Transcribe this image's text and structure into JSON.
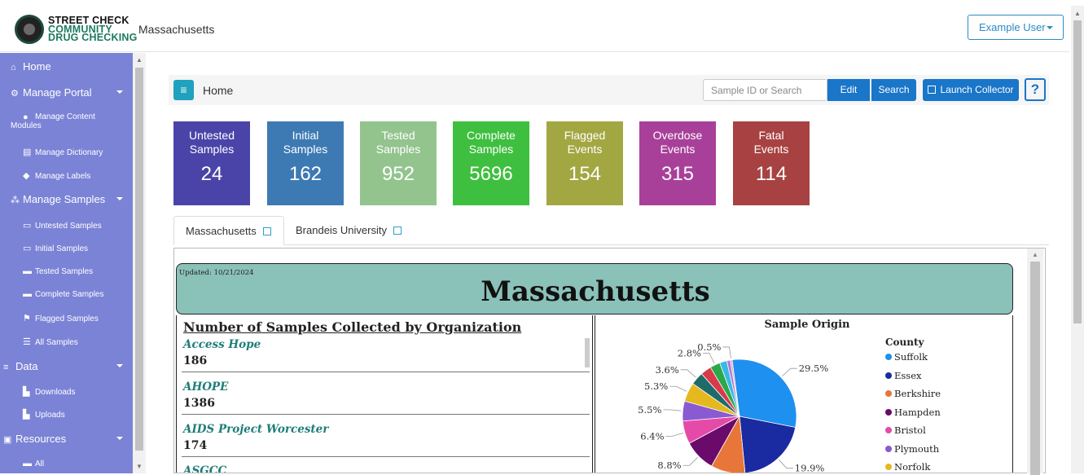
{
  "header": {
    "logo_line1": "STREET CHECK",
    "logo_line2": "COMMUNITY",
    "logo_line3": "DRUG CHECKING",
    "site_title": "Massachusetts",
    "user_menu": "Example User"
  },
  "sidebar": {
    "home": "Home",
    "manage_portal": "Manage Portal",
    "manage_content_line1": "Manage Content",
    "manage_content_line2": "Modules",
    "manage_dictionary": "Manage Dictionary",
    "manage_labels": "Manage Labels",
    "manage_samples": "Manage Samples",
    "untested": "Untested Samples",
    "initial": "Initial Samples",
    "tested": "Tested Samples",
    "complete": "Complete Samples",
    "flagged": "Flagged Samples",
    "all_samples": "All Samples",
    "data": "Data",
    "downloads": "Downloads",
    "uploads": "Uploads",
    "resources": "Resources",
    "all": "All"
  },
  "toolbar": {
    "crumb": "Home",
    "search_placeholder": "Sample ID or Search",
    "edit": "Edit",
    "search": "Search",
    "launch": "Launch Collector",
    "help": "?"
  },
  "tiles": [
    {
      "l1": "Untested",
      "l2": "Samples",
      "v": "24",
      "color": "#4b44a8"
    },
    {
      "l1": "Initial",
      "l2": "Samples",
      "v": "162",
      "color": "#3d7ab3"
    },
    {
      "l1": "Tested",
      "l2": "Samples",
      "v": "952",
      "color": "#93c48e"
    },
    {
      "l1": "Complete",
      "l2": "Samples",
      "v": "5696",
      "color": "#3fbf3f"
    },
    {
      "l1": "Flagged",
      "l2": "Events",
      "v": "154",
      "color": "#a3a742"
    },
    {
      "l1": "Overdose",
      "l2": "Events",
      "v": "315",
      "color": "#a8409a"
    },
    {
      "l1": "Fatal",
      "l2": "Events",
      "v": "114",
      "color": "#a84242"
    }
  ],
  "tabs": {
    "massachusetts": "Massachusetts",
    "brandeis": "Brandeis University"
  },
  "report": {
    "updated": "Updated: 10/21/2024",
    "title": "Massachusetts",
    "org_heading": "Number of Samples Collected by Organization",
    "orgs": [
      {
        "name": "Access Hope",
        "value": "186"
      },
      {
        "name": "AHOPE",
        "value": "1386"
      },
      {
        "name": "AIDS Project Worcester",
        "value": "174"
      },
      {
        "name": "ASGCC",
        "value": ""
      }
    ]
  },
  "chart_data": {
    "type": "pie",
    "title": "Sample Origin",
    "legend_title": "County",
    "legend_position": "right",
    "slices": [
      {
        "label": "Suffolk",
        "value": 29.5,
        "color": "#1e90f0",
        "text": "29.5%"
      },
      {
        "label": "Essex",
        "value": 19.9,
        "color": "#1a2aa0",
        "text": "19.9%"
      },
      {
        "label": "Berkshire",
        "value": 9.5,
        "color": "#e8763a",
        "text": ""
      },
      {
        "label": "Hampden",
        "value": 8.8,
        "color": "#6a0a6a",
        "text": "8.8%"
      },
      {
        "label": "Bristol",
        "value": 6.4,
        "color": "#e64aa8",
        "text": "6.4%"
      },
      {
        "label": "Plymouth",
        "value": 5.5,
        "color": "#8a5ad0",
        "text": "5.5%"
      },
      {
        "label": "Norfolk",
        "value": 5.3,
        "color": "#e6b820",
        "text": "5.3%"
      },
      {
        "label": "",
        "value": 3.6,
        "color": "#1f6b6b",
        "text": "3.6%"
      },
      {
        "label": "",
        "value": 3.0,
        "color": "#d83a4a",
        "text": ""
      },
      {
        "label": "",
        "value": 2.8,
        "color": "#2aa84a",
        "text": "2.8%"
      },
      {
        "label": "",
        "value": 2.0,
        "color": "#3ab8e6",
        "text": ""
      },
      {
        "label": "",
        "value": 1.0,
        "color": "#b07ad8",
        "text": ""
      },
      {
        "label": "",
        "value": 0.5,
        "color": "#e89ab8",
        "text": "0.5%"
      }
    ]
  }
}
